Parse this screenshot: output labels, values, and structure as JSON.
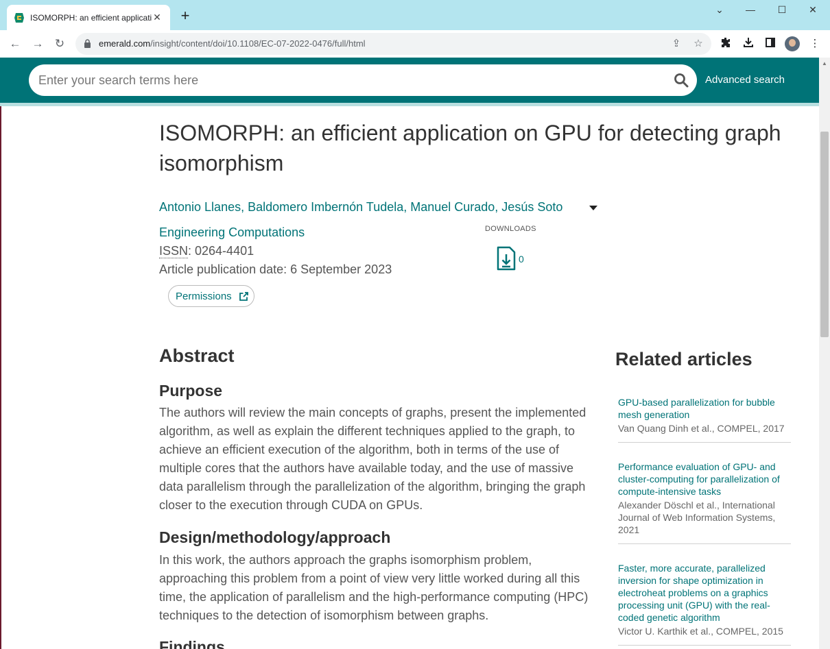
{
  "browser": {
    "tab_title": "ISOMORPH: an efficient applicati",
    "url_host": "emerald.com",
    "url_path": "/insight/content/doi/10.1108/EC-07-2022-0476/full/html"
  },
  "header": {
    "search_placeholder": "Enter your search terms here",
    "advanced_search": "Advanced search",
    "brand_color": "#007377"
  },
  "article": {
    "title": "ISOMORPH: an efficient application on GPU for detecting graph isomorphism",
    "authors": "Antonio Llanes, Baldomero Imbernón Tudela, Manuel Curado, Jesús Soto",
    "journal": "Engineering Computations",
    "issn_label": "ISSN",
    "issn_value": ": 0264-4401",
    "pub_date": "Article publication date: 6 September 2023",
    "permissions": "Permissions",
    "downloads_label": "DOWNLOADS",
    "downloads_count": "0"
  },
  "abstract": {
    "heading": "Abstract",
    "sections": [
      {
        "heading": "Purpose",
        "text": "The authors will review the main concepts of graphs, present the implemented algorithm, as well as explain the different techniques applied to the graph, to achieve an efficient execution of the algorithm, both in terms of the use of multiple cores that the authors have available today, and the use of massive data parallelism through the parallelization of the algorithm, bringing the graph closer to the execution through CUDA on GPUs."
      },
      {
        "heading": "Design/methodology/approach",
        "text": "In this work, the authors approach the graphs isomorphism problem, approaching this problem from a point of view very little worked during all this time, the application of parallelism and the high-performance computing (HPC) techniques to the detection of isomorphism between graphs."
      },
      {
        "heading": "Findings",
        "text": ""
      }
    ]
  },
  "related": {
    "heading": "Related articles",
    "items": [
      {
        "title": "GPU-based parallelization for bubble mesh generation",
        "meta": "Van Quang Dinh et al., COMPEL, 2017"
      },
      {
        "title": "Performance evaluation of GPU- and cluster-computing for parallelization of compute-intensive tasks",
        "meta": "Alexander Döschl et al., International Journal of Web Information Systems, 2021"
      },
      {
        "title": "Faster, more accurate, parallelized inversion for shape optimization in electroheat problems on a graphics processing unit (GPU) with the real-coded genetic algorithm",
        "meta": "Victor U. Karthik et al., COMPEL, 2015"
      }
    ]
  }
}
